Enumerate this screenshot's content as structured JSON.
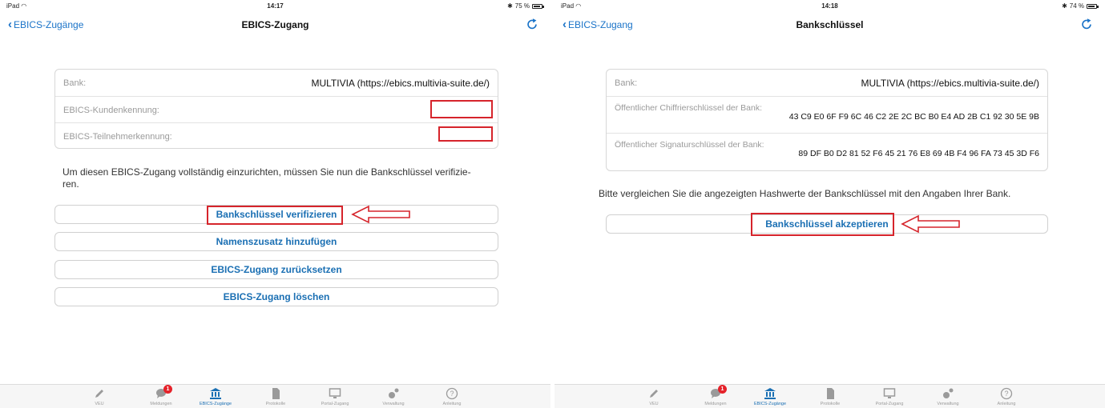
{
  "left": {
    "status": {
      "device": "iPad",
      "time": "14:17",
      "battery": "75 %",
      "battery_level": 0.75
    },
    "nav": {
      "back_label": "EBICS-Zugänge",
      "title": "EBICS-Zugang"
    },
    "info_rows": [
      {
        "label": "Bank:",
        "value": "MULTIVIA (https://ebics.multivia-suite.de/)"
      },
      {
        "label": "EBICS-Kundenkennung:",
        "value": ""
      },
      {
        "label": "EBICS-Teilnehmerkennung:",
        "value": ""
      }
    ],
    "info_text_line1": "Um diesen EBICS-Zugang vollständig einzurichten, müssen Sie nun die Bankschlüssel verifizie-",
    "info_text_line2": "ren.",
    "buttons": {
      "verify": "Bankschlüssel verifizieren",
      "name_suffix": "Namenszusatz hinzufügen",
      "reset": "EBICS-Zugang zurücksetzen",
      "delete": "EBICS-Zugang löschen"
    }
  },
  "right": {
    "status": {
      "device": "iPad",
      "time": "14:18",
      "battery": "74 %",
      "battery_level": 0.74
    },
    "nav": {
      "back_label": "EBICS-Zugang",
      "title": "Bankschlüssel"
    },
    "bank": {
      "label": "Bank:",
      "value": "MULTIVIA (https://ebics.multivia-suite.de/)"
    },
    "keys": [
      {
        "label": "Öffentlicher Chiffrierschlüssel der Bank:",
        "value": "43 C9 E0 6F F9 6C 46 C2 2E 2C BC B0 E4 AD 2B C1 92 30 5E 9B"
      },
      {
        "label": "Öffentlicher Signaturschlüssel der Bank:",
        "value": "89 DF B0 D2 81 52 F6 45 21 76 E8 69 4B F4 96 FA 73 45 3D F6"
      }
    ],
    "compare_text": "Bitte vergleichen Sie die angezeigten Hashwerte der Bankschlüssel mit den Angaben Ihrer Bank.",
    "accept_button": "Bankschlüssel akzeptieren"
  },
  "tab_bar": {
    "tabs": [
      {
        "label": "VEU",
        "icon": "pencil-icon"
      },
      {
        "label": "Meldungen",
        "icon": "chat-bubble-icon",
        "badge": "1"
      },
      {
        "label": "EBICS-Zugänge",
        "icon": "bank-icon",
        "active": true
      },
      {
        "label": "Protokolle",
        "icon": "document-icon"
      },
      {
        "label": "Portal-Zugang",
        "icon": "monitor-icon"
      },
      {
        "label": "Verwaltung",
        "icon": "gears-icon"
      },
      {
        "label": "Anleitung",
        "icon": "help-circle-icon"
      }
    ]
  },
  "colors": {
    "accent": "#1a6fb3",
    "highlight": "#d6242b",
    "badge": "#e5222a"
  }
}
